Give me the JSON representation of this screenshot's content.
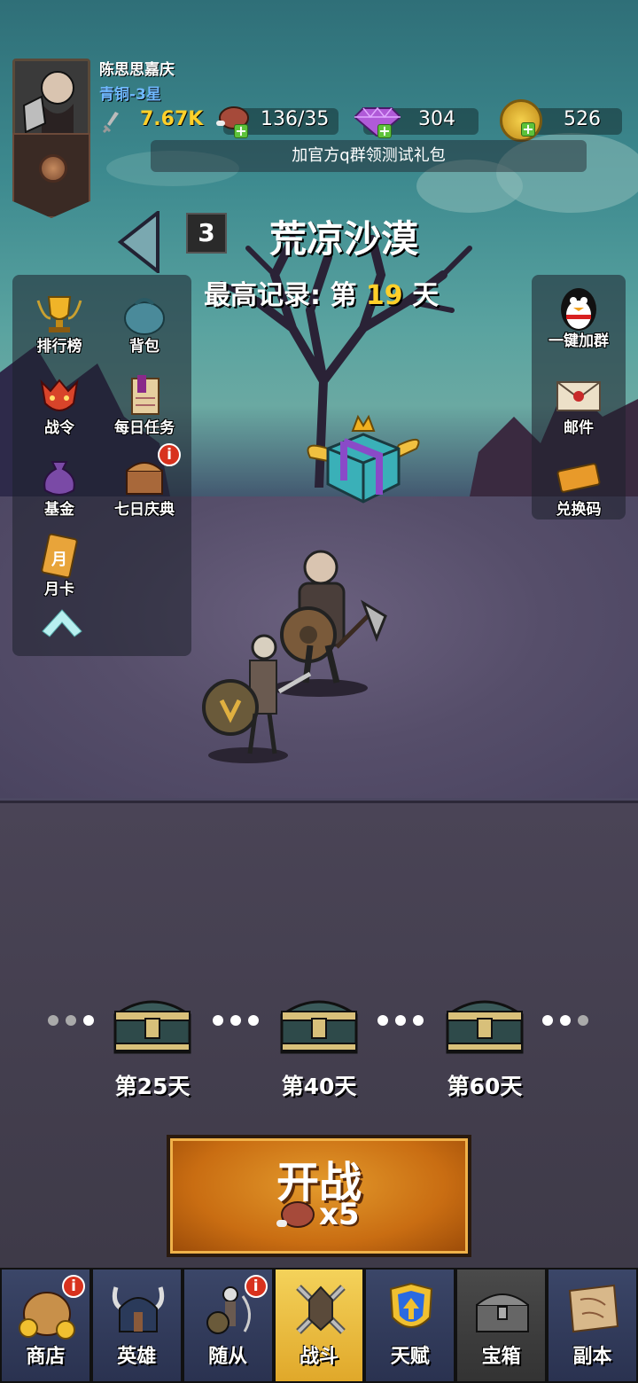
{
  "player": {
    "name": "陈思思嘉庆",
    "rank": "青铜-3星",
    "power": "7.67K",
    "stamina": "136/35",
    "gems": "304",
    "coins": "526"
  },
  "notice": "加官方q群领测试礼包",
  "stage": {
    "number": "3",
    "title": "荒凉沙漠",
    "record_prefix": "最高记录: 第",
    "record_day": "19",
    "record_suffix": "天"
  },
  "left_menu": {
    "ranking": "排行榜",
    "backpack": "背包",
    "battle_pass": "战令",
    "daily_tasks": "每日任务",
    "fund": "基金",
    "seven_day": "七日庆典",
    "monthly_card": "月卡",
    "monthly_card_glyph": "月",
    "badge": "i"
  },
  "right_menu": {
    "join_group": "一键加群",
    "mail": "邮件",
    "redeem": "兑换码"
  },
  "chests": [
    {
      "label": "第25天"
    },
    {
      "label": "第40天"
    },
    {
      "label": "第60天"
    }
  ],
  "battle": {
    "label": "开战",
    "cost": "x5"
  },
  "nav": {
    "shop": "商店",
    "heroes": "英雄",
    "followers": "随从",
    "battle": "战斗",
    "talent": "天赋",
    "chest": "宝箱",
    "dungeon": "副本",
    "badge": "i"
  },
  "colors": {
    "accent_gold": "#ffd02a",
    "rank_blue": "#6fb8ff",
    "active_tab": "#f4d25a",
    "badge_red": "#d8321e"
  }
}
